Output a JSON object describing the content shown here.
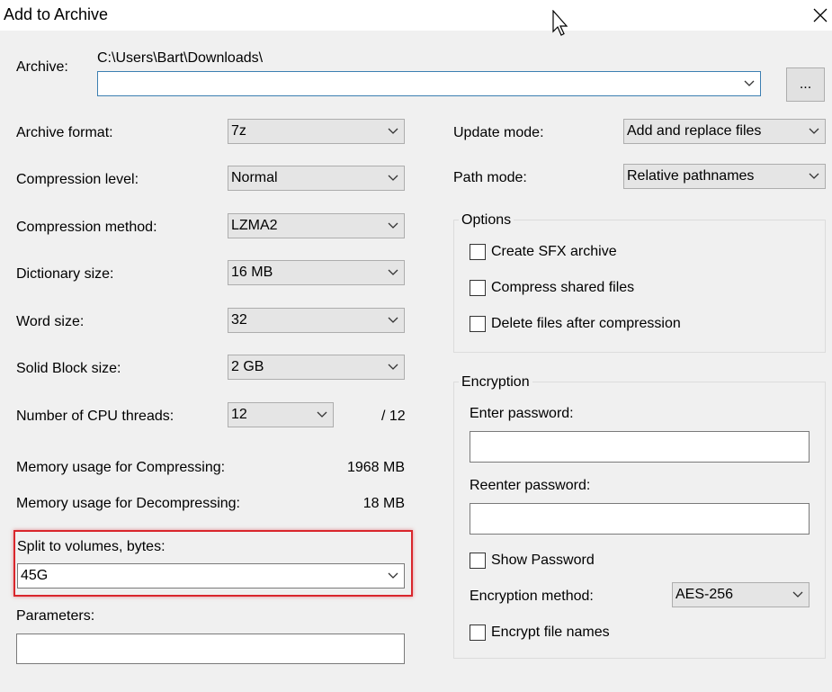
{
  "window": {
    "title": "Add to Archive"
  },
  "archive": {
    "label": "Archive:",
    "path": "C:\\Users\\Bart\\Downloads\\",
    "value": "",
    "browse_label": "..."
  },
  "left": {
    "archive_format": {
      "label": "Archive format:",
      "value": "7z"
    },
    "compression_level": {
      "label": "Compression level:",
      "value": "Normal"
    },
    "compression_method": {
      "label": "Compression method:",
      "value": "LZMA2"
    },
    "dictionary_size": {
      "label": "Dictionary size:",
      "value": "16 MB"
    },
    "word_size": {
      "label": "Word size:",
      "value": "32"
    },
    "solid_block_size": {
      "label": "Solid Block size:",
      "value": "2 GB"
    },
    "cpu_threads": {
      "label": "Number of CPU threads:",
      "value": "12",
      "max": "/ 12"
    },
    "memory_compress": {
      "label": "Memory usage for Compressing:",
      "value": "1968 MB"
    },
    "memory_decompress": {
      "label": "Memory usage for Decompressing:",
      "value": "18 MB"
    },
    "split_volumes": {
      "label": "Split to volumes, bytes:",
      "value": "45G"
    },
    "parameters": {
      "label": "Parameters:",
      "value": ""
    }
  },
  "right": {
    "update_mode": {
      "label": "Update mode:",
      "value": "Add and replace files"
    },
    "path_mode": {
      "label": "Path mode:",
      "value": "Relative pathnames"
    },
    "options": {
      "title": "Options",
      "create_sfx": "Create SFX archive",
      "compress_shared": "Compress shared files",
      "delete_after": "Delete files after compression"
    },
    "encryption": {
      "title": "Encryption",
      "enter_password_label": "Enter password:",
      "reenter_password_label": "Reenter password:",
      "show_password": "Show Password",
      "method_label": "Encryption method:",
      "method_value": "AES-256",
      "encrypt_names": "Encrypt file names"
    }
  },
  "colors": {
    "highlight": "#d9262c",
    "focus_border": "#3c7fb1",
    "dialog_bg": "#f0f0f0"
  }
}
